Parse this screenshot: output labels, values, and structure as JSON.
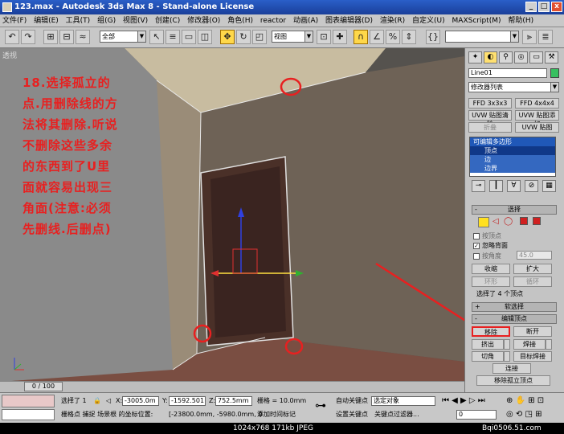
{
  "window": {
    "title": "123.max - Autodesk 3ds Max 8 - Stand-alone License",
    "controls": [
      "_",
      "□",
      "x"
    ]
  },
  "menu": [
    "文件(F)",
    "编辑(E)",
    "工具(T)",
    "组(G)",
    "视图(V)",
    "创建(C)",
    "修改器(O)",
    "角色(H)",
    "reactor",
    "动画(A)",
    "图表编辑器(D)",
    "渲染(R)",
    "自定义(U)",
    "MAXScript(M)",
    "帮助(H)"
  ],
  "toolbar": {
    "selection_filter": "全部",
    "ref_coord": "视图"
  },
  "viewport": {
    "label": "透视",
    "annotation": [
      "18.选择孤立的",
      "点.用删除线的方",
      "法将其删除.听说",
      "不删除这些多余",
      "的东西到了U里",
      "面就容易出现三",
      "角面(注意:必须",
      "先删线.后删点)"
    ],
    "annotation_color": "#e82020",
    "axis_colors": {
      "x": "#e03030",
      "y": "#30b030",
      "z": "#3040e0"
    }
  },
  "command_panel": {
    "object_name": "Line01",
    "object_color": "#38c060",
    "modifier_list": "修改器列表",
    "modifier_buttons": [
      [
        "FFD 3x3x3",
        "FFD 4x4x4"
      ],
      [
        "UVW 贴图清除",
        "UVW 贴图添加"
      ],
      [
        "折叠",
        "UVW 贴图"
      ]
    ],
    "stack": [
      "可编辑多边形",
      "顶点",
      "边",
      "边界"
    ],
    "selection_rollout": "选择",
    "by_vertex": "按顶点",
    "ignore_backfacing": "忽略背面",
    "by_angle": "按角度",
    "angle_value": "45.0",
    "shrink": "收缩",
    "grow": "扩大",
    "ring": "环形",
    "loop": "循环",
    "selected_info": "选择了 4 个顶点",
    "soft_selection": "软选择",
    "edit_vertices": "编辑顶点",
    "remove": "移除",
    "break": "断开",
    "extrude": "挤出",
    "weld": "焊接",
    "chamfer": "切角",
    "target_weld": "目标焊接",
    "connect": "连接",
    "remove_isolated": "移除孤立顶点"
  },
  "timeslider": {
    "frame": "0 / 100"
  },
  "status": {
    "selected": "选择了 1",
    "x": "-3005.0m",
    "y": "-1592.501",
    "z": "752.5mm",
    "grid": "栅格 = 10.0mm",
    "auto_key": "自动关键点",
    "set_key": "设置关键点",
    "selected_object": "选定对象",
    "key_filters": "关键点过滤器...",
    "line2_a": "栅格点 捕捉 场景根 的坐标位置:",
    "line2_b": "[-23800.0mm, -5980.0mm, 0",
    "add_time_tag": "添加时间标记",
    "frame_field": "0"
  },
  "footer": {
    "image_info": "1024x768  171kb  JPEG",
    "watermark": "Bqi0506.51.com"
  }
}
